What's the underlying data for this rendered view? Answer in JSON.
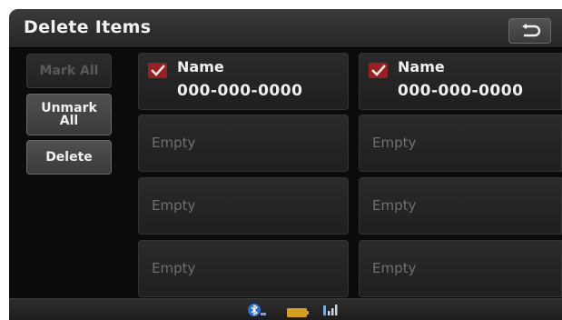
{
  "header": {
    "title": "Delete Items",
    "back_icon": "back-arrow-icon"
  },
  "side_buttons": {
    "mark_all": "Mark All",
    "unmark_all_line1": "Unmark",
    "unmark_all_line2": "All",
    "delete": "Delete"
  },
  "grid": {
    "items": [
      {
        "checked": true,
        "name": "Name",
        "number": "000-000-0000"
      },
      {
        "checked": true,
        "name": "Name",
        "number": "000-000-0000"
      },
      {
        "label": "Empty"
      },
      {
        "label": "Empty"
      },
      {
        "label": "Empty"
      },
      {
        "label": "Empty"
      },
      {
        "label": "Empty"
      },
      {
        "label": "Empty"
      }
    ]
  },
  "status_bar": {
    "icons": [
      "bluetooth-icon",
      "battery-icon",
      "signal-icon"
    ]
  },
  "colors": {
    "background": "#0b0b0b",
    "header": "#2e2e2e",
    "check": "#9a1f23",
    "empty_text": "#707070"
  }
}
